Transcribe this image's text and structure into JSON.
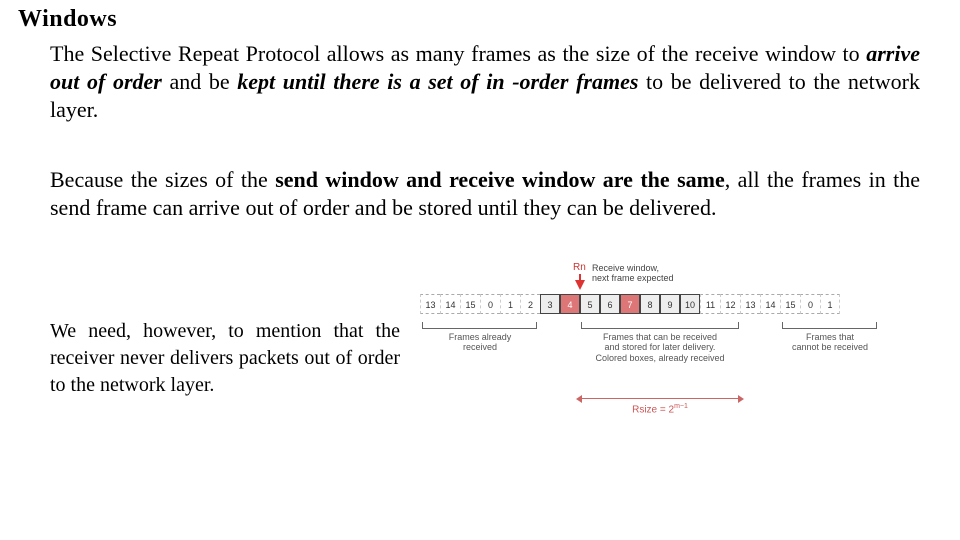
{
  "heading": "Windows",
  "p1a": "The Selective Repeat Protocol allows as many frames as the size of the receive window to ",
  "p1b": "arrive out of order",
  "p1c": " and be ",
  "p1d": "kept until there is a set of in -order frames",
  "p1e": " to be delivered to the network layer.",
  "p2a": "Because the sizes of the ",
  "p2b": "send window and receive window are the same",
  "p2c": ", all the frames in the send frame can arrive out of order and be stored until they can be delivered.",
  "p3": "We need, however, to mention that the receiver never delivers packets out of order to the network layer.",
  "diagram": {
    "rn": "Rn",
    "topLabel1": "Receive window,",
    "topLabel2": "next frame expected",
    "cells": [
      "13",
      "14",
      "15",
      "0",
      "1",
      "2",
      "3",
      "4",
      "5",
      "6",
      "7",
      "8",
      "9",
      "10",
      "11",
      "12",
      "13",
      "14",
      "15",
      "0",
      "1"
    ],
    "winStart": 6,
    "winEnd": 13,
    "redIndices": [
      7,
      10
    ],
    "leftCap1": "Frames already",
    "leftCap2": "received",
    "midCap1": "Frames that can be received",
    "midCap2": "and stored for later delivery.",
    "midCap3": "Colored boxes, already received",
    "rightCap1": "Frames that",
    "rightCap2": "cannot be received",
    "rsizeLabel": "Rsize = 2",
    "rsizeExp": "m−1"
  }
}
